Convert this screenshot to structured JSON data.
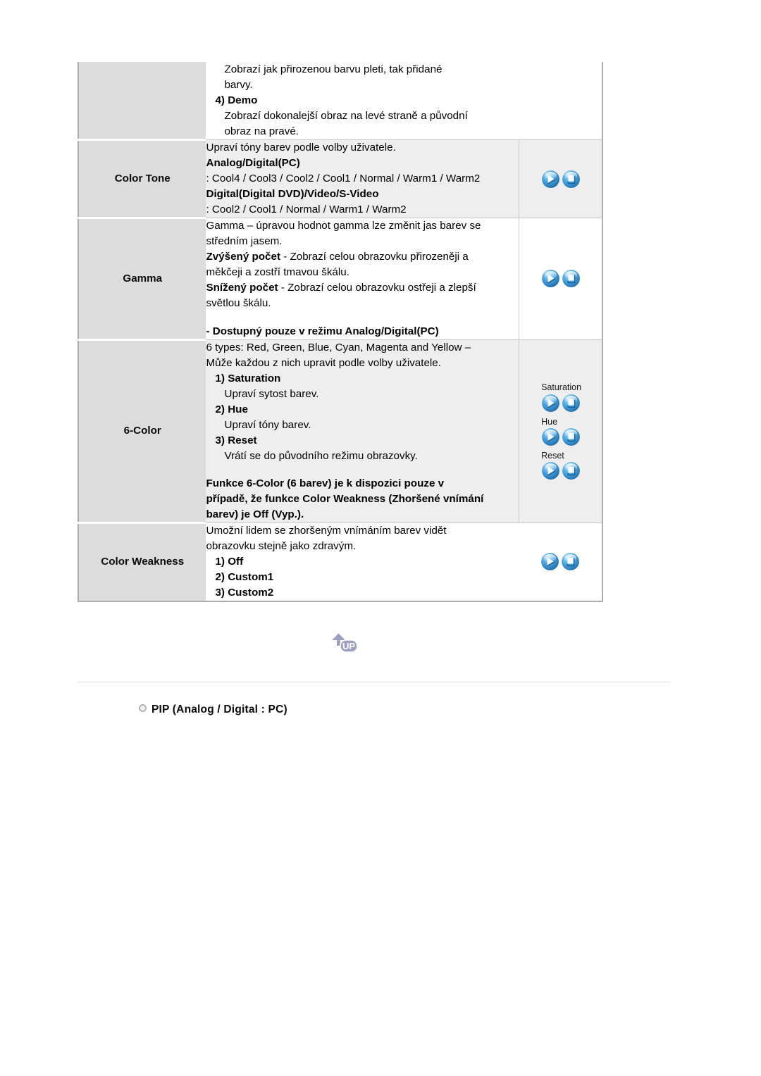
{
  "table": {
    "rows": [
      {
        "label": "",
        "shade": false,
        "lines": [
          {
            "style": "indent",
            "text": "Zobrazí jak přirozenou barvu pleti, tak přidané"
          },
          {
            "style": "indent",
            "text": "barvy."
          },
          {
            "style": "head",
            "text": "4) Demo"
          },
          {
            "style": "indent",
            "text": "Zobrazí dokonalejší obraz na levé straně a původní"
          },
          {
            "style": "indent",
            "text": "obraz na pravé."
          }
        ],
        "buttons": []
      },
      {
        "label": "Color Tone",
        "shade": true,
        "lines": [
          {
            "style": "plain",
            "text": "Upraví tóny barev podle volby uživatele."
          },
          {
            "style": "bold",
            "text": "Analog/Digital(PC)"
          },
          {
            "style": "plain",
            "text": ": Cool4 / Cool3 / Cool2 / Cool1 / Normal / Warm1 / Warm2"
          },
          {
            "style": "bold",
            "text": "Digital(Digital DVD)/Video/S-Video"
          },
          {
            "style": "plain",
            "text": ": Cool2 / Cool1 / Normal / Warm1 / Warm2"
          }
        ],
        "buttons": [
          {
            "caption": ""
          }
        ]
      },
      {
        "label": "Gamma",
        "shade": false,
        "lines": [
          {
            "style": "plain",
            "text": "Gamma – úpravou hodnot gamma lze změnit jas barev se"
          },
          {
            "style": "plain",
            "text": "středním jasem."
          },
          {
            "style": "mixed",
            "bold": "Zvýšený počet",
            "text": " - Zobrazí celou obrazovku přirozeněji a"
          },
          {
            "style": "plain",
            "text": "měkčeji a zostří tmavou škálu."
          },
          {
            "style": "mixed",
            "bold": "Snížený počet",
            "text": " - Zobrazí celou obrazovku ostřeji a zlepší"
          },
          {
            "style": "plain",
            "text": "světlou škálu."
          },
          {
            "style": "spacer",
            "text": ""
          },
          {
            "style": "note",
            "text": "- Dostupný pouze v režimu Analog/Digital(PC)"
          }
        ],
        "buttons": [
          {
            "caption": ""
          }
        ]
      },
      {
        "label": "6-Color",
        "shade": true,
        "lines": [
          {
            "style": "plain",
            "text": "6 types: Red, Green, Blue, Cyan, Magenta and Yellow –"
          },
          {
            "style": "plain",
            "text": "Může každou z nich upravit podle volby uživatele."
          },
          {
            "style": "head",
            "text": "1) Saturation"
          },
          {
            "style": "indent",
            "text": "Upraví sytost barev."
          },
          {
            "style": "head",
            "text": "2) Hue"
          },
          {
            "style": "indent",
            "text": "Upraví tóny barev."
          },
          {
            "style": "head",
            "text": "3) Reset"
          },
          {
            "style": "indent",
            "text": "Vrátí se do původního režimu obrazovky."
          },
          {
            "style": "spacer",
            "text": ""
          },
          {
            "style": "note",
            "text": "Funkce 6-Color (6 barev) je k dispozici pouze v"
          },
          {
            "style": "note",
            "text": "případě, že funkce Color Weakness (Zhoršené vnímání"
          },
          {
            "style": "note",
            "text": "barev) je Off (Vyp.)."
          }
        ],
        "buttons": [
          {
            "caption": "Saturation"
          },
          {
            "caption": "Hue"
          },
          {
            "caption": "Reset"
          }
        ]
      },
      {
        "label": "Color Weakness",
        "shade": false,
        "lines": [
          {
            "style": "plain",
            "text": "Umožní lidem se zhoršeným vnímáním barev vidět"
          },
          {
            "style": "plain",
            "text": "obrazovku stejně jako zdravým."
          },
          {
            "style": "head",
            "text": "1) Off"
          },
          {
            "style": "head",
            "text": "2) Custom1"
          },
          {
            "style": "head",
            "text": "3) Custom2"
          }
        ],
        "buttons": [
          {
            "caption": ""
          }
        ]
      }
    ]
  },
  "up_button": {
    "label": "UP",
    "icon": "up-arrow-icon"
  },
  "section_heading": {
    "bullet_icon": "circle-bullet-icon",
    "text": "PIP (Analog / Digital : PC)"
  },
  "icons": {
    "enter_button": "osd-enter-button-icon",
    "return_button": "osd-return-button-icon"
  },
  "colors": {
    "label_column_bg": "#dcdcdc",
    "shaded_row_bg": "#eeeeee",
    "table_border": "#adadad",
    "button_blue": "#2e90d4",
    "up_button_fill": "#9ea0c2"
  }
}
